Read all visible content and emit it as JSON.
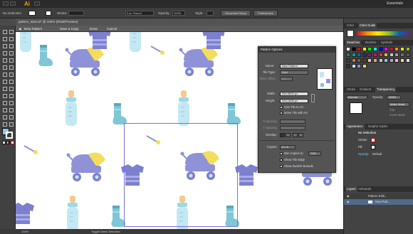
{
  "app": {
    "logo": "Ai",
    "workspace": "Essentials"
  },
  "control_bar": {
    "selection": "No Selection",
    "stroke_label": "Stroke:",
    "stroke_profile": "3 pt. Round",
    "opacity_label": "Opacity:",
    "opacity_value": "100%",
    "style_label": "Style:",
    "doc_setup": "Document Setup",
    "preferences": "Preferences"
  },
  "document": {
    "tab_title": "pattern_start.ai* @ 100% (RGB/Preview)"
  },
  "pattern_bar": {
    "new_pattern": "New Pattern",
    "save_copy": "Save a Copy",
    "done": "Done",
    "cancel": "Cancel"
  },
  "pattern_options": {
    "title": "Pattern Options",
    "name_label": "Name:",
    "name_value": "New Pattern",
    "tile_type_label": "Tile Type:",
    "tile_type_value": "Grid",
    "brick_offset_label": "Brick Offset:",
    "brick_offset_value": "1/2",
    "width_label": "Width:",
    "width_value": "394.9833 px",
    "height_label": "Height:",
    "height_value": "393.1838 px",
    "size_tile_to_art": "Size Tile to Art",
    "move_tile_with_art": "Move Tile with Art",
    "h_spacing_label": "H Spacing:",
    "v_spacing_label": "V Spacing:",
    "overlap_label": "Overlap:",
    "copies_label": "Copies:",
    "copies_value": "5 x 5",
    "dim_copies_label": "Dim Copies to:",
    "dim_copies_value": "70%",
    "show_tile_edge": "Show Tile Edge",
    "show_swatch_bounds": "Show Swatch Bounds"
  },
  "dock": {
    "color_tab": "Color",
    "color_guide_tab": "Color Guide",
    "swatches_tab": "Swatches",
    "brushes_tab": "Brushes",
    "symbols_tab": "Symbols",
    "stroke_tab": "Stroke",
    "gradient_tab": "Gradient",
    "transparency_tab": "Transparency",
    "blend_mode": "Normal",
    "opacity_label": "Opacity:",
    "opacity_value": "100%",
    "make_mask": "Make Mask",
    "clip": "Clip",
    "invert_mask": "Invert Mask",
    "appearance_tab": "Appearance",
    "graphic_styles_tab": "Graphic Styles",
    "no_selection": "No Selection",
    "stroke_row": "Stroke:",
    "fill_row": "Fill:",
    "opacity_row": "Opacity:",
    "opacity_row_value": "Default",
    "layers_tab": "Layers",
    "artboards_tab": "Artboards",
    "layer1": "Pattern Editi...",
    "layer2": "New Patt..."
  },
  "status": {
    "zoom": "100%",
    "tool": "Toggle Direct Selection"
  },
  "colors": {
    "accent": "#7a6ee0",
    "buggy_purple": "#8f92d6",
    "buggy_yellow": "#f2de5c",
    "bottle_blue": "#c4e8f3",
    "bottle_nipple": "#f4c98d",
    "sock_teal": "#7fc6d6",
    "onesie_purple": "#7d80cf"
  },
  "swatch_colors": [
    "#ffffff",
    "#000000",
    "#ff0000",
    "#ffff00",
    "#00ff00",
    "#00ffff",
    "#0000ff",
    "#ff00ff",
    "#c8102e",
    "#f39200",
    "#ffe600",
    "#95c11f",
    "#009640",
    "#00a19a",
    "#0069b4",
    "#312783",
    "#662483",
    "#e6007e",
    "#e5332a",
    "#f9b233",
    "#c6c6c6",
    "#9d9d9c",
    "#706f6f",
    "#575756",
    "#3c3c3b",
    "#b17f4a",
    "#7f5a36",
    "#5b3f28",
    "#f5c6a5",
    "#dea77d",
    "#a2d9ce",
    "#8fcae7",
    "#b3a5d3",
    "#f6b7d2",
    "#ffd7a0",
    "#e3e3e3",
    "#333333",
    "#c4e8f3",
    "#8f92d6",
    "#f2de5c"
  ]
}
